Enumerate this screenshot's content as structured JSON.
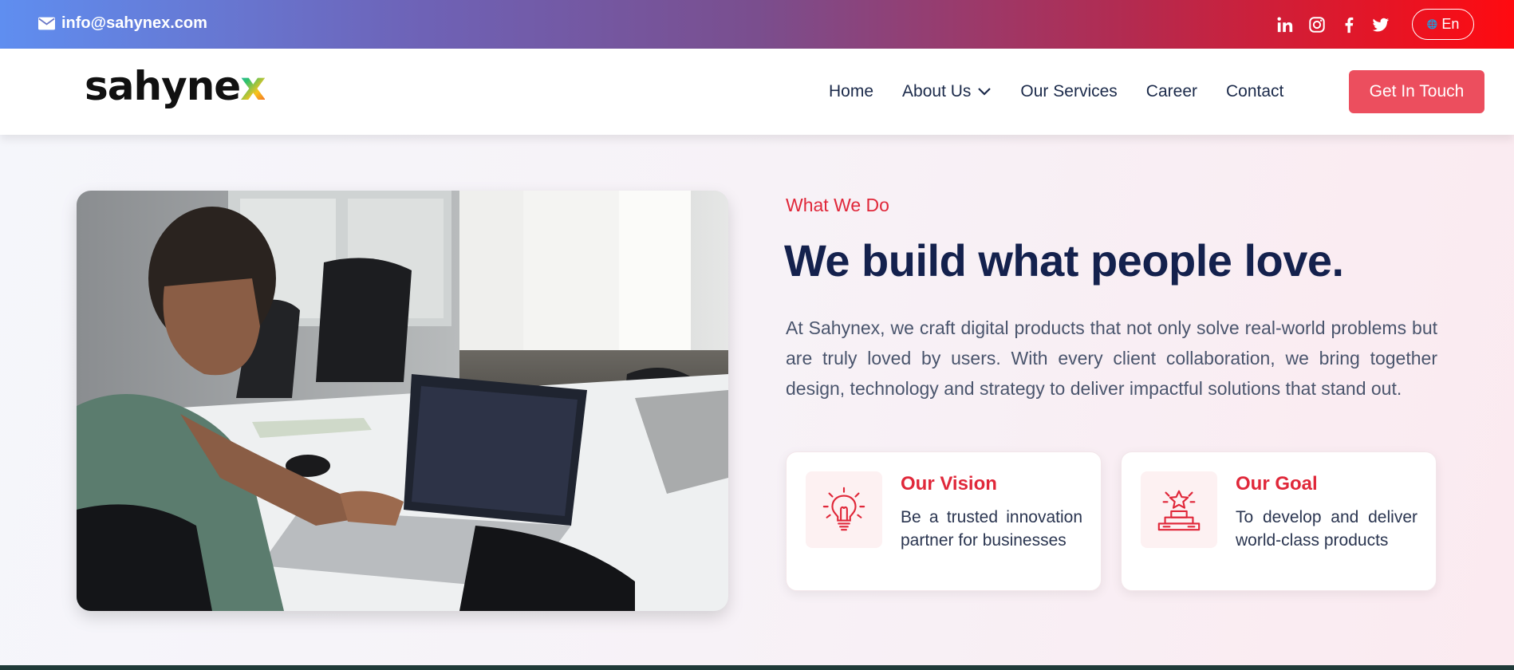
{
  "topbar": {
    "email": "info@sahynex.com",
    "social": [
      "linkedin-icon",
      "instagram-icon",
      "facebook-icon",
      "twitter-icon"
    ],
    "language": "En",
    "gradient": [
      "#5f8ef0",
      "#ff0a10"
    ]
  },
  "nav": {
    "logo_main": "sahyne",
    "logo_accent": "x",
    "items": [
      {
        "label": "Home"
      },
      {
        "label": "About Us",
        "has_dropdown": true
      },
      {
        "label": "Our Services"
      },
      {
        "label": "Career"
      },
      {
        "label": "Contact"
      }
    ],
    "cta": "Get In Touch",
    "cta_color": "#ec4e5e"
  },
  "hero": {
    "eyebrow": "What We Do",
    "headline": "We build what people love.",
    "paragraph": "At Sahynex, we craft digital products that not only solve real-world problems but are truly loved by users. With every client collaboration, we bring together design, technology and strategy to deliver impactful solutions that stand out.",
    "accent_color": "#e0283a",
    "heading_color": "#14214d"
  },
  "cards": [
    {
      "title": "Our Vision",
      "text": "Be a trusted innovation partner for businesses",
      "icon": "lightbulb-icon"
    },
    {
      "title": "Our Goal",
      "text": "To develop and deliver world-class products",
      "icon": "trophy-podium-icon"
    }
  ]
}
